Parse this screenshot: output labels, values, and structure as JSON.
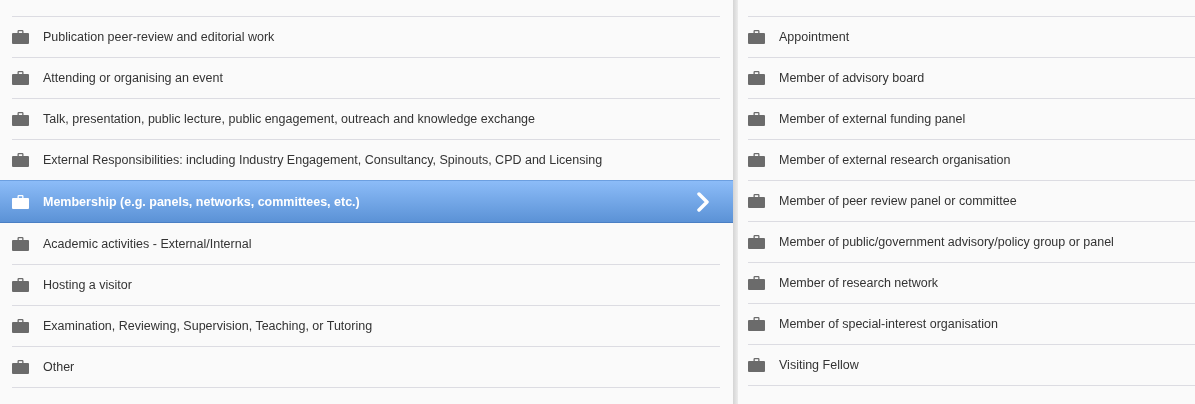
{
  "categories": [
    {
      "label": "Publication peer-review and editorial work",
      "selected": false
    },
    {
      "label": "Attending or organising an event",
      "selected": false
    },
    {
      "label": "Talk, presentation, public lecture, public engagement, outreach and knowledge exchange",
      "selected": false
    },
    {
      "label": "External Responsibilities: including Industry Engagement, Consultancy, Spinouts, CPD and Licensing",
      "selected": false
    },
    {
      "label": "Membership (e.g. panels, networks, committees, etc.)",
      "selected": true
    },
    {
      "label": "Academic activities - External/Internal",
      "selected": false
    },
    {
      "label": "Hosting a visitor",
      "selected": false
    },
    {
      "label": "Examination, Reviewing, Supervision, Teaching, or Tutoring",
      "selected": false
    },
    {
      "label": "Other",
      "selected": false
    }
  ],
  "subcategories": [
    {
      "label": "Appointment",
      "selected": false
    },
    {
      "label": "Member of advisory board",
      "selected": false
    },
    {
      "label": "Member of external funding panel",
      "selected": false
    },
    {
      "label": "Member of external research organisation",
      "selected": false
    },
    {
      "label": "Member of peer review panel or committee",
      "selected": false
    },
    {
      "label": "Member of public/government advisory/policy group or panel",
      "selected": false
    },
    {
      "label": "Member of research network",
      "selected": false
    },
    {
      "label": "Member of special-interest organisation",
      "selected": false
    },
    {
      "label": "Visiting Fellow",
      "selected": false
    }
  ]
}
